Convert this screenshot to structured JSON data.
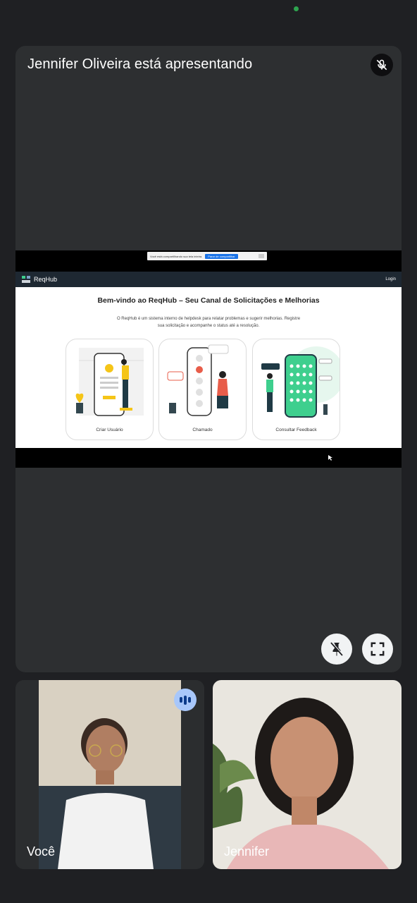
{
  "presentation": {
    "title": "Jennifer Oliveira está apresentando",
    "share_bar": {
      "message": "Você está compartilhando sua tela inteira.",
      "stop_label": "Parar de compartilhar"
    },
    "app": {
      "name": "ReqHub",
      "login_label": "Login",
      "heading": "Bem-vindo ao ReqHub – Seu Canal de Solicitações e Melhorias",
      "description": "O ReqHub é um sistema interno de helpdesk para relatar problemas e sugerir melhorias. Registre sua solicitação e acompanhe o status até a resolução.",
      "cards": [
        {
          "label": "Criar Usuário"
        },
        {
          "label": "Chamado"
        },
        {
          "label": "Consultar Feedback"
        }
      ]
    }
  },
  "controls": {
    "unpin_icon": "pin-off-icon",
    "fullscreen_icon": "fullscreen-icon"
  },
  "participants": [
    {
      "name": "Você",
      "speaking": true
    },
    {
      "name": "Jennifer",
      "speaking": false
    }
  ],
  "colors": {
    "background": "#1f2023",
    "tile": "#2d2f31",
    "speaking_indicator": "#a8c7fa",
    "app_header": "#1e2832",
    "accent_green": "#3ecf8e"
  }
}
